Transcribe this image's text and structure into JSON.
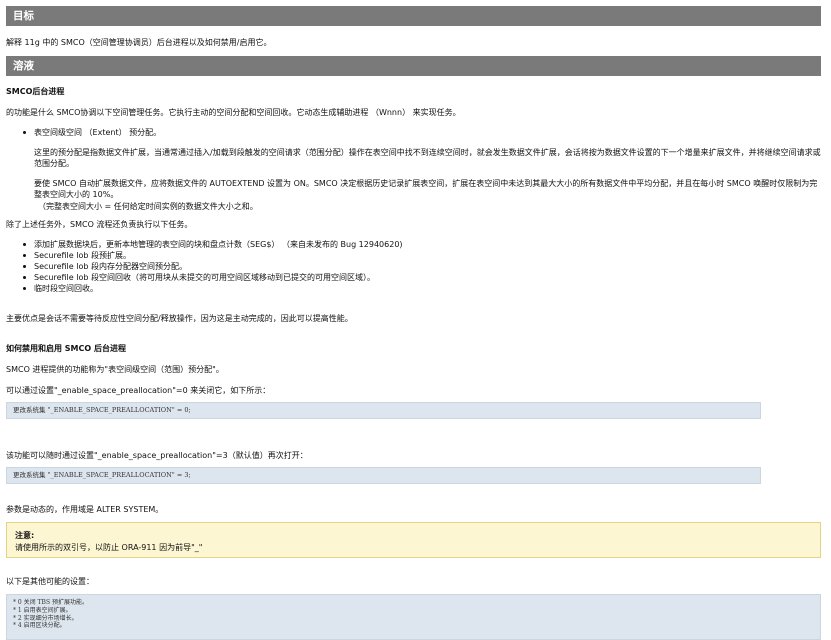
{
  "section_goal": {
    "heading": "目标",
    "text": "解释 11g 中的 SMCO（空间管理协调员）后台进程以及如何禁用/启用它。"
  },
  "section_solution": {
    "heading": "溶液",
    "smco_title": "SMCO后台进程",
    "intro": "的功能是什么 SMCO协调以下空间管理任务。它执行主动的空间分配和空间回收。它动态生成辅助进程 （Wnnn） 来实现任务。",
    "bullet_extent": "表空间级空间 （Extent） 预分配。",
    "para1": "这里的预分配是指数据文件扩展，当通常通过插入/加载到段触发的空间请求（范围分配）操作在表空间中找不到连续空间时，就会发生数据文件扩展，会话将按为数据文件设置的下一个增量来扩展文件，并将继续空间请求或范围分配。",
    "para2": "要使 SMCO 自动扩展数据文件，应将数据文件的 AUTOEXTEND 设置为 ON。SMCO 决定根据历史记录扩展表空间，扩展在表空间中未达到其最大大小的所有数据文件中平均分配，并且在每小时 SMCO 唤醒时仅限制为完整表空间大小的 10%。",
    "para3": "（完整表空间大小 = 任何给定时间实例的数据文件大小之和。",
    "besides": "除了上述任务外，SMCO 流程还负责执行以下任务。",
    "tasks": [
      "添加扩展数据块后，更新本地管理的表空间的块和盘点计数（SEG$） （来自未发布的 Bug 12940620)",
      "Securefile lob 段预扩展。",
      "Securefile lob 段内存分配器空间预分配。",
      "Securefile lob 段空间回收（将可用块从未提交的可用空间区域移动到已提交的可用空间区域）。",
      "临时段空间回收。"
    ],
    "advantage": "主要优点是会话不需要等待反应性空间分配/释放操作，因为这是主动完成的，因此可以提高性能。",
    "howto_title": "如何禁用和启用 SMCO 后台进程",
    "howto_intro": "SMCO 进程提供的功能称为\"表空间级空间（范围）预分配\"。",
    "disable_text": "可以通过设置\"_enable_space_preallocation\"=0 来关闭它，如下所示：",
    "disable_code": "更改系统集 \"_ENABLE_SPACE_PREALLOCATION\" = 0;",
    "enable_text": "该功能可以随时通过设置\"_enable_space_preallocation\"=3（默认值）再次打开：",
    "enable_code": "更改系统集 \"_ENABLE_SPACE_PREALLOCATION\" = 3;",
    "dynamic_text": "参数是动态的，作用域是 ALTER SYSTEM。",
    "note": {
      "title": "注意:",
      "text": "请使用所示的双引号，以防止 ORA-911 因为前导\"_\""
    },
    "other_settings_title": "以下是其他可能的设置：",
    "other_settings": [
      "* 0 关闭 TBS 预扩展功能。",
      "* 1 启用表空间扩展。",
      "* 2 实现细分市场增长。",
      "* 4 启用区块分配。"
    ]
  }
}
